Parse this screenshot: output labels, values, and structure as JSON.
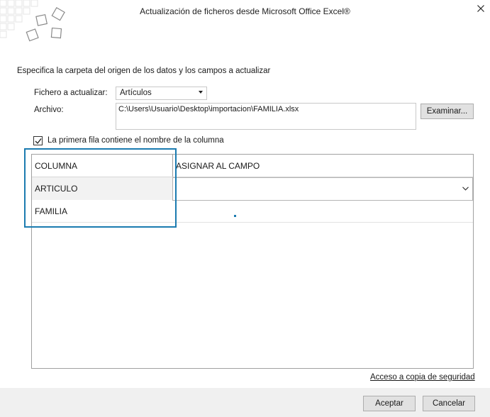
{
  "window": {
    "title": "Actualización de ficheros desde Microsoft Office Excel®"
  },
  "form": {
    "section_label": "Especifica la carpeta del origen de los datos y los campos a actualizar",
    "fichero_label": "Fichero a actualizar:",
    "fichero_value": "Artículos",
    "archivo_label": "Archivo:",
    "archivo_value": "C:\\Users\\Usuario\\Desktop\\importacion\\FAMILIA.xlsx",
    "examinar_label": "Examinar...",
    "checkbox_label": "La primera fila contiene el nombre de la columna",
    "checkbox_checked": true
  },
  "grid": {
    "headers": [
      "COLUMNA",
      "ASIGNAR AL CAMPO"
    ],
    "rows": [
      {
        "columna": "ARTICULO",
        "campo": ""
      },
      {
        "columna": "FAMILIA",
        "campo": ""
      }
    ]
  },
  "footer": {
    "backup_link": "Acceso a copia de seguridad",
    "accept_label": "Aceptar",
    "cancel_label": "Cancelar"
  },
  "colors": {
    "accent": "#1b7bb0",
    "footer_bg": "#f0f0f0",
    "button_bg": "#e1e1e1"
  },
  "icons": [
    "app-logo-icon",
    "close-icon",
    "dropdown-arrow-icon",
    "checkmark-icon",
    "chevron-down-icon"
  ]
}
